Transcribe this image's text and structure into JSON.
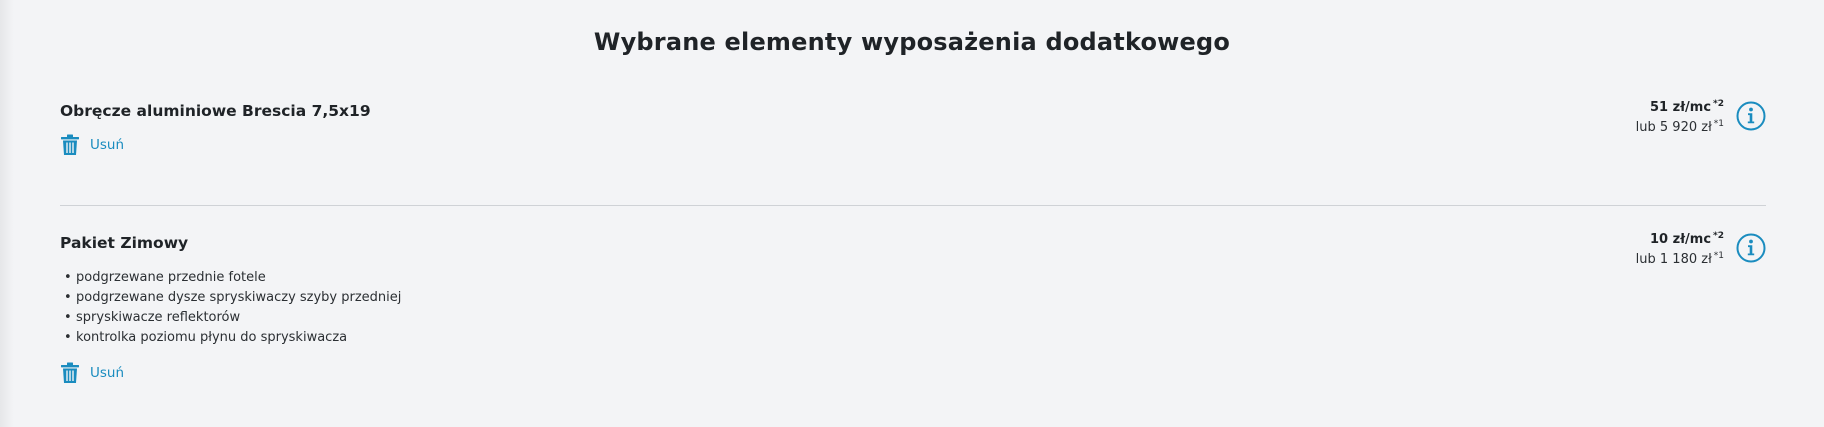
{
  "page": {
    "title": "Wybrane elementy wyposażenia dodatkowego"
  },
  "items": [
    {
      "title": "Obręcze aluminiowe Brescia 7,5x19",
      "price_monthly": "51 zł/mc",
      "price_monthly_note": "*2",
      "price_total": "lub 5 920 zł",
      "price_total_note": "*1",
      "features": [],
      "remove_label": "Usuń"
    },
    {
      "title": "Pakiet Zimowy",
      "price_monthly": "10 zł/mc",
      "price_monthly_note": "*2",
      "price_total": "lub 1 180 zł",
      "price_total_note": "*1",
      "features": [
        "podgrzewane przednie fotele",
        "podgrzewane dysze spryskiwaczy szyby przedniej",
        "spryskiwacze reflektorów",
        "kontrolka poziomu płynu do spryskiwacza"
      ],
      "remove_label": "Usuń"
    }
  ],
  "icons": {
    "remove": "trash-icon",
    "info": "info-icon"
  },
  "colors": {
    "accent": "#1a8cbf",
    "background": "#f3f4f6",
    "divider": "#cfd2d6",
    "text": "#1f2327"
  }
}
